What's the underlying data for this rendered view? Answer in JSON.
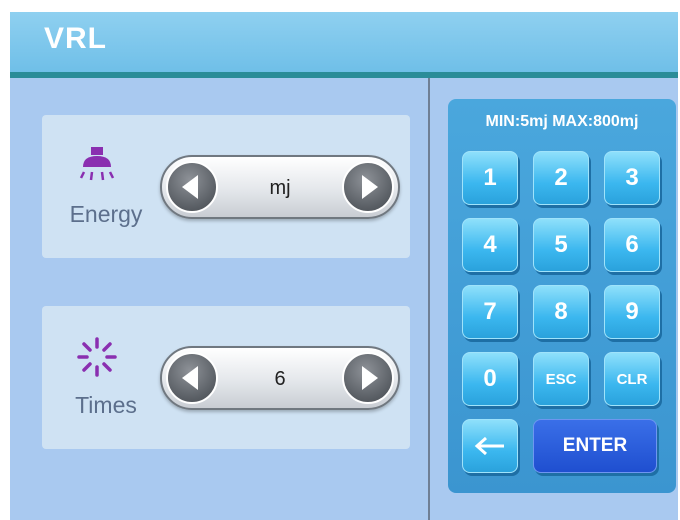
{
  "header": {
    "title": "VRL"
  },
  "energy": {
    "label": "Energy",
    "value": "mj",
    "icon": "lamp-icon"
  },
  "times": {
    "label": "Times",
    "value": "6",
    "icon": "sunburst-icon"
  },
  "keypad": {
    "range": "MIN:5mj MAX:800mj",
    "keys": {
      "k1": "1",
      "k2": "2",
      "k3": "3",
      "k4": "4",
      "k5": "5",
      "k6": "6",
      "k7": "7",
      "k8": "8",
      "k9": "9",
      "k0": "0",
      "esc": "ESC",
      "clr": "CLR",
      "enter": "ENTER"
    }
  },
  "colors": {
    "accent": "#4aa7dd",
    "icon": "#8a2fb0",
    "enter": "#1f4fd0"
  }
}
